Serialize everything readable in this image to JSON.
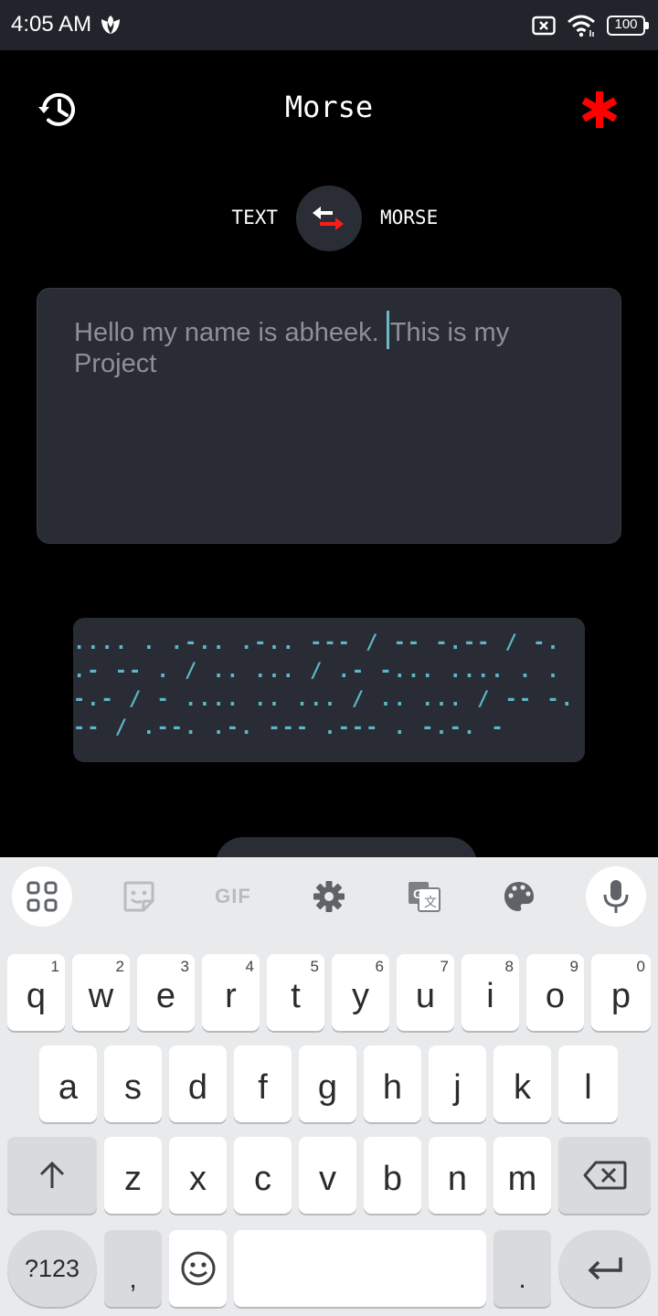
{
  "status_bar": {
    "time": "4:05 AM",
    "battery": "100",
    "icons": [
      "app-notification-icon",
      "no-sim-icon",
      "wifi-icon",
      "battery-icon"
    ]
  },
  "header": {
    "title": "Morse",
    "history_icon": "history-icon",
    "menu_icon": "asterisk-icon",
    "accent_color": "#ff0000"
  },
  "mode": {
    "from": "TEXT",
    "to": "MORSE",
    "swap_icon": "swap-arrows-icon"
  },
  "input": {
    "text_before_cursor": "Hello my name is abheek. ",
    "text_after_cursor": "This is my Project"
  },
  "output": {
    "morse": ".... . .-.. .-.. --- / -- -.-- / -. .- -- . / .. ... / .- -... .... . . -.- / - .... .. ... / .. ... / -- -.-- / .--. .-. --- .--- . -.-. -",
    "color": "#5db7c9"
  },
  "keyboard": {
    "toolbar": [
      "apps-icon",
      "sticker-icon",
      "GIF",
      "settings-icon",
      "translate-icon",
      "palette-icon",
      "mic-icon"
    ],
    "gif_label": "GIF",
    "row1": [
      {
        "key": "q",
        "hint": "1"
      },
      {
        "key": "w",
        "hint": "2"
      },
      {
        "key": "e",
        "hint": "3"
      },
      {
        "key": "r",
        "hint": "4"
      },
      {
        "key": "t",
        "hint": "5"
      },
      {
        "key": "y",
        "hint": "6"
      },
      {
        "key": "u",
        "hint": "7"
      },
      {
        "key": "i",
        "hint": "8"
      },
      {
        "key": "o",
        "hint": "9"
      },
      {
        "key": "p",
        "hint": "0"
      }
    ],
    "row2": [
      "a",
      "s",
      "d",
      "f",
      "g",
      "h",
      "j",
      "k",
      "l"
    ],
    "row3": [
      "z",
      "x",
      "c",
      "v",
      "b",
      "n",
      "m"
    ],
    "row4": {
      "symbols": "?123",
      "comma": ",",
      "period": "."
    }
  }
}
